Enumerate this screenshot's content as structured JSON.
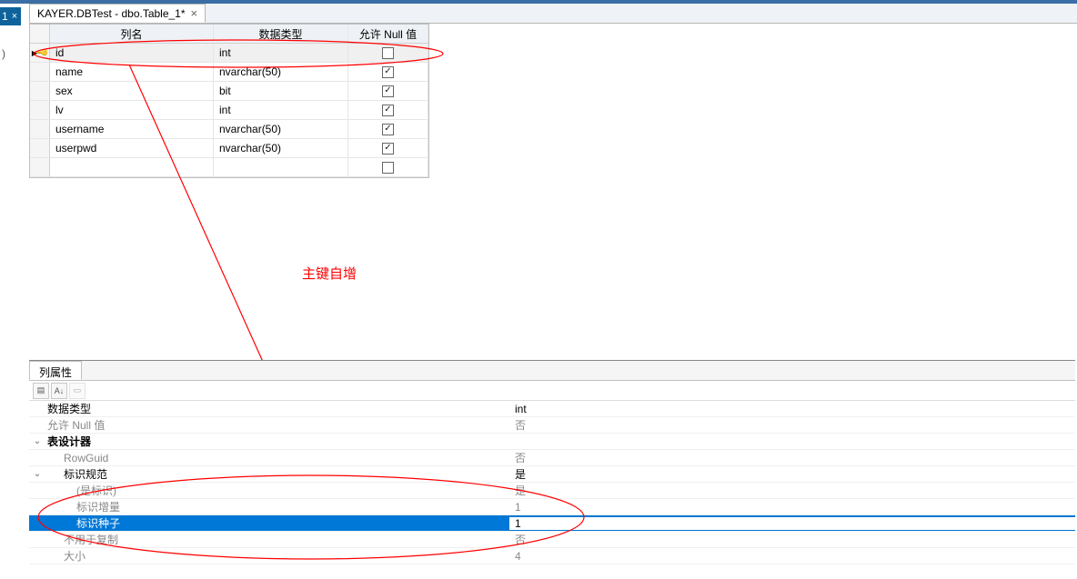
{
  "tabbar": {
    "partial_tab_close": "×",
    "active_tab": "KAYER.DBTest - dbo.Table_1*",
    "tab_close": "×"
  },
  "grid": {
    "headers": {
      "name": "列名",
      "type": "数据类型",
      "null": "允许 Null 值"
    },
    "rows": [
      {
        "key": true,
        "name": "id",
        "type": "int",
        "null": false
      },
      {
        "key": false,
        "name": "name",
        "type": "nvarchar(50)",
        "null": true
      },
      {
        "key": false,
        "name": "sex",
        "type": "bit",
        "null": true
      },
      {
        "key": false,
        "name": "lv",
        "type": "int",
        "null": true
      },
      {
        "key": false,
        "name": "username",
        "type": "nvarchar(50)",
        "null": true
      },
      {
        "key": false,
        "name": "userpwd",
        "type": "nvarchar(50)",
        "null": true
      }
    ]
  },
  "annotation": {
    "text": "主键自增"
  },
  "props": {
    "panel_title": "列属性",
    "rows": [
      {
        "kind": "plain",
        "name": "数据类型",
        "value": "int"
      },
      {
        "kind": "dim",
        "name": "允许 Null 值",
        "value": "否"
      },
      {
        "kind": "boldexp",
        "name": "表设计器",
        "value": ""
      },
      {
        "kind": "dim indent1",
        "name": "RowGuid",
        "value": "否"
      },
      {
        "kind": "exp indent1",
        "name": "标识规范",
        "value": "是"
      },
      {
        "kind": "dim indent2",
        "name": "(是标识)",
        "value": "是"
      },
      {
        "kind": "dim indent2",
        "name": "标识增量",
        "value": "1"
      },
      {
        "kind": "sel indent2",
        "name": "标识种子",
        "value": "1"
      },
      {
        "kind": "dim indent1",
        "name": "不用于复制",
        "value": "否"
      },
      {
        "kind": "dim indent1",
        "name": "大小",
        "value": "4"
      }
    ]
  },
  "left_paren": ")"
}
